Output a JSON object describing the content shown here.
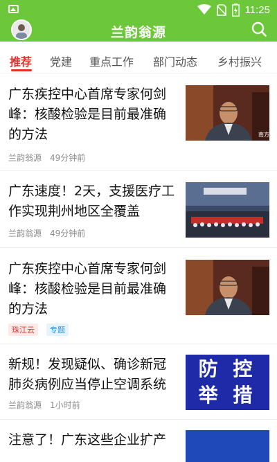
{
  "status_bar": {
    "time": "11:25",
    "icons": [
      "image-icon",
      "wifi-icon",
      "no-sim-icon",
      "battery-charging-icon"
    ]
  },
  "app": {
    "title": "兰韵翁源",
    "brand_color": "#6cc83a",
    "accent_color": "#e0322c"
  },
  "tabs": [
    {
      "label": "推荐",
      "active": true
    },
    {
      "label": "党建",
      "active": false
    },
    {
      "label": "重点工作",
      "active": false
    },
    {
      "label": "部门动态",
      "active": false
    },
    {
      "label": "乡村振兴",
      "active": false
    }
  ],
  "articles": [
    {
      "title": "广东疾控中心首席专家何剑峰：核酸检验是目前最准确的方法",
      "source": "兰韵翁源",
      "time": "49分钟前",
      "thumb": "portrait-expert"
    },
    {
      "title": "广东速度！2天，支援医疗工作实现荆州地区全覆盖",
      "source": "兰韵翁源",
      "time": "49分钟前",
      "thumb": "airport-team"
    },
    {
      "title": "广东疾控中心首席专家何剑峰：核酸检验是目前最准确的方法",
      "tags": [
        "珠江云",
        "专题"
      ],
      "thumb": "portrait-expert"
    },
    {
      "title": "新规！发现疑似、确诊新冠肺炎病例应当停止空调系统",
      "source": "兰韵翁源",
      "time": "1小时前",
      "thumb": "prevention-poster",
      "thumb_text": "防 控举 措"
    },
    {
      "title": "注意了！广东这些企业扩产",
      "thumb": "blue-banner"
    }
  ]
}
